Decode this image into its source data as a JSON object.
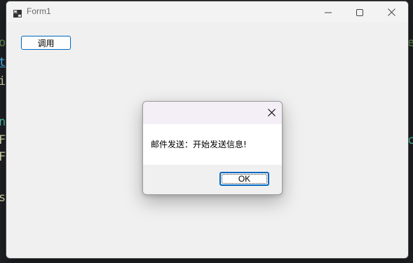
{
  "window": {
    "title": "Form1",
    "icons": {
      "app": "app-icon",
      "minimize": "minimize-icon",
      "maximize": "maximize-icon",
      "close": "close-icon"
    }
  },
  "form": {
    "call_button_label": "调用"
  },
  "dialog": {
    "message": "邮件发送：开始发送信息!",
    "ok_label": "OK",
    "close_icon": "close-icon"
  },
  "background_code_glyphs": {
    "left": [
      "o",
      "t",
      "i",
      "n",
      "F",
      "F",
      "s"
    ],
    "right": [
      "e",
      "c"
    ]
  },
  "colors": {
    "accent": "#0067c0",
    "dialog_title_tint": "#f4eef6",
    "window_bg": "#f0f0f0",
    "desktop_bg": "#1f2125"
  }
}
